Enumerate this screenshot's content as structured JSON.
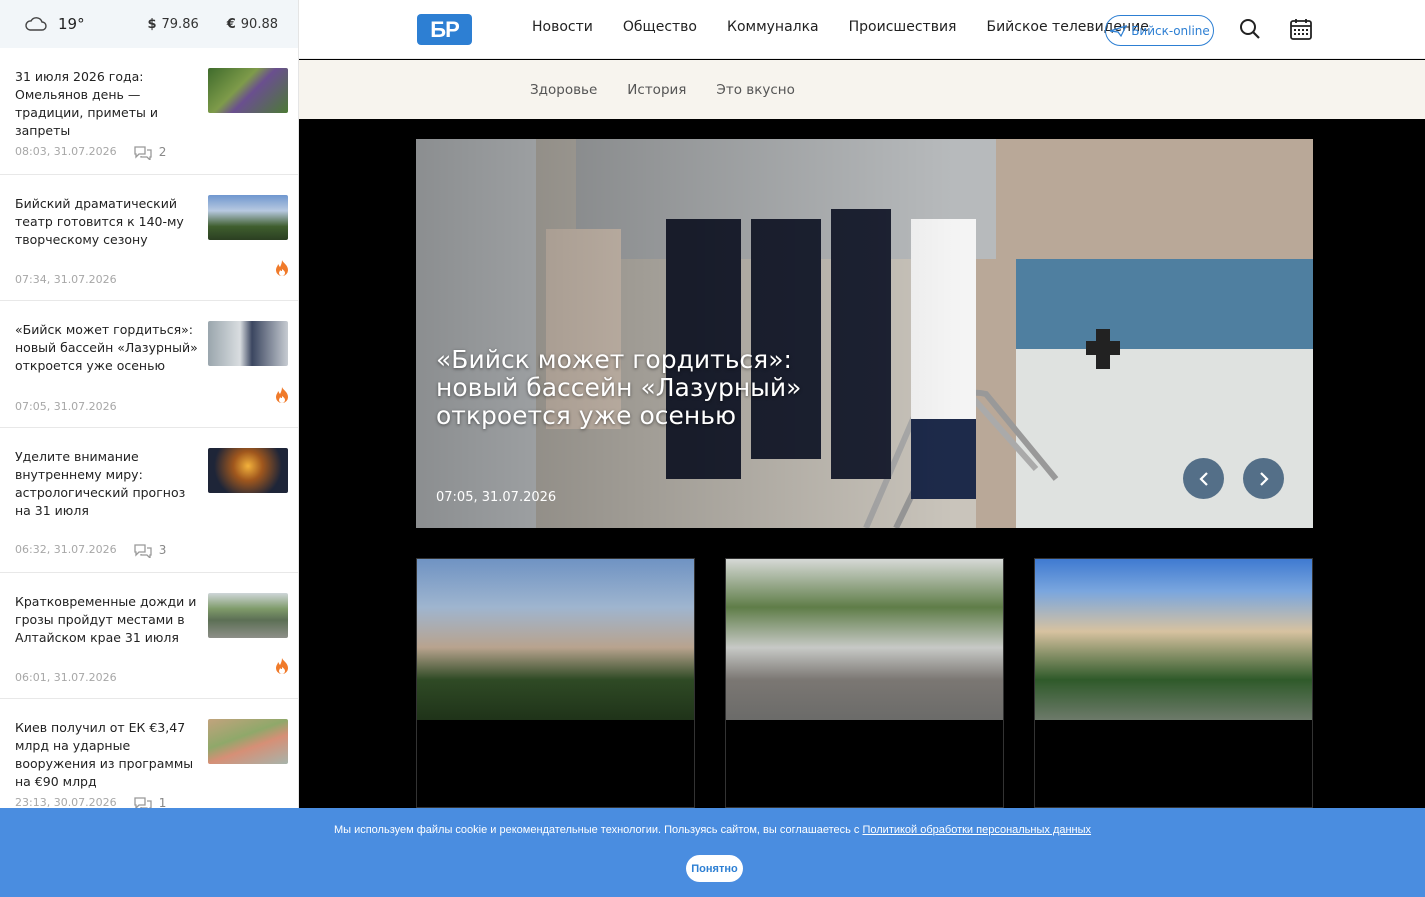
{
  "weather": {
    "temp": "19°",
    "usd_symbol": "$",
    "usd": "79.86",
    "eur_symbol": "€",
    "eur": "90.88"
  },
  "sidebar": {
    "items": [
      {
        "title": "31 июля 2026 года: Омельянов день — традиции, приметы и запреты",
        "time": "08:03, 31.07.2026",
        "comments": "2"
      },
      {
        "title": "Бийский драматический театр готовится к 140-му творческому сезону",
        "time": "07:34, 31.07.2026",
        "hot": true
      },
      {
        "title": "«Бийск может гордиться»: новый бассейн «Лазурный» откроется уже осенью",
        "time": "07:05, 31.07.2026",
        "hot": true
      },
      {
        "title": "Уделите внимание внутреннему миру: астрологический прогноз на 31 июля",
        "time": "06:32, 31.07.2026",
        "comments": "3"
      },
      {
        "title": "Кратковременные дожди и грозы пройдут местами в Алтайском крае 31 июля",
        "time": "06:01, 31.07.2026",
        "hot": true
      },
      {
        "title": "Киев получил от ЕК €3,47 млрд на ударные вооружения из программы на €90 млрд",
        "time": "23:13, 30.07.2026",
        "comments": "1"
      }
    ]
  },
  "header": {
    "logo": "БР",
    "nav": [
      "Новости",
      "Общество",
      "Коммуналка",
      "Происшествия",
      "Бийское телевидение"
    ],
    "online_label": "Бийск-online"
  },
  "subnav": [
    "Здоровье",
    "История",
    "Это вкусно"
  ],
  "hero": {
    "title": "«Бийск может гордиться»: новый бассейн «Лазурный» откроется уже осенью",
    "date": "07:05, 31.07.2026"
  },
  "cookie": {
    "text": "Мы используем файлы cookie и рекомендательные технологии. Пользуясь сайтом, вы соглашаетесь с ",
    "link": "Политикой обработки персональных данных",
    "button": "Понятно"
  },
  "colors": {
    "brand": "#2d7fd3",
    "cookie_bg": "#4a8de0",
    "hot": "#f07a2a"
  }
}
